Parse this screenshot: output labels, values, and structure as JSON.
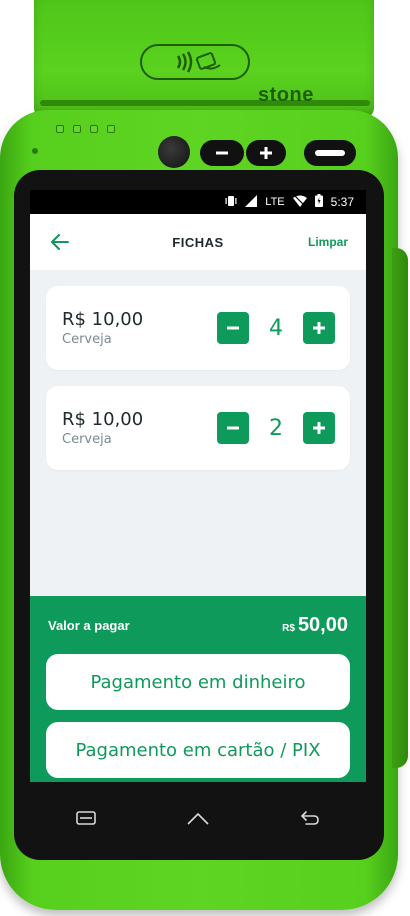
{
  "device": {
    "brand": "stone"
  },
  "status_bar": {
    "time": "5:37",
    "network": "LTE",
    "icons": [
      "vibrate-icon",
      "signal-icon",
      "wifi-icon",
      "battery-icon"
    ]
  },
  "app_bar": {
    "back_icon": "arrow-left-icon",
    "title": "FICHAS",
    "clear_label": "Limpar"
  },
  "items": [
    {
      "price": "R$ 10,00",
      "name": "Cerveja",
      "quantity": "4"
    },
    {
      "price": "R$ 10,00",
      "name": "Cerveja",
      "quantity": "2"
    }
  ],
  "footer": {
    "total_label": "Valor a pagar",
    "total_currency": "R$",
    "total_amount": "50,00",
    "cash_button": "Pagamento em dinheiro",
    "card_button": "Pagamento em cartão / PIX"
  },
  "nav_bar": {
    "icons": [
      "menu-icon",
      "home-icon",
      "back-icon"
    ]
  },
  "colors": {
    "accent": "#0e9a5a",
    "device_green": "#5ed522",
    "background": "#eef2f5"
  }
}
